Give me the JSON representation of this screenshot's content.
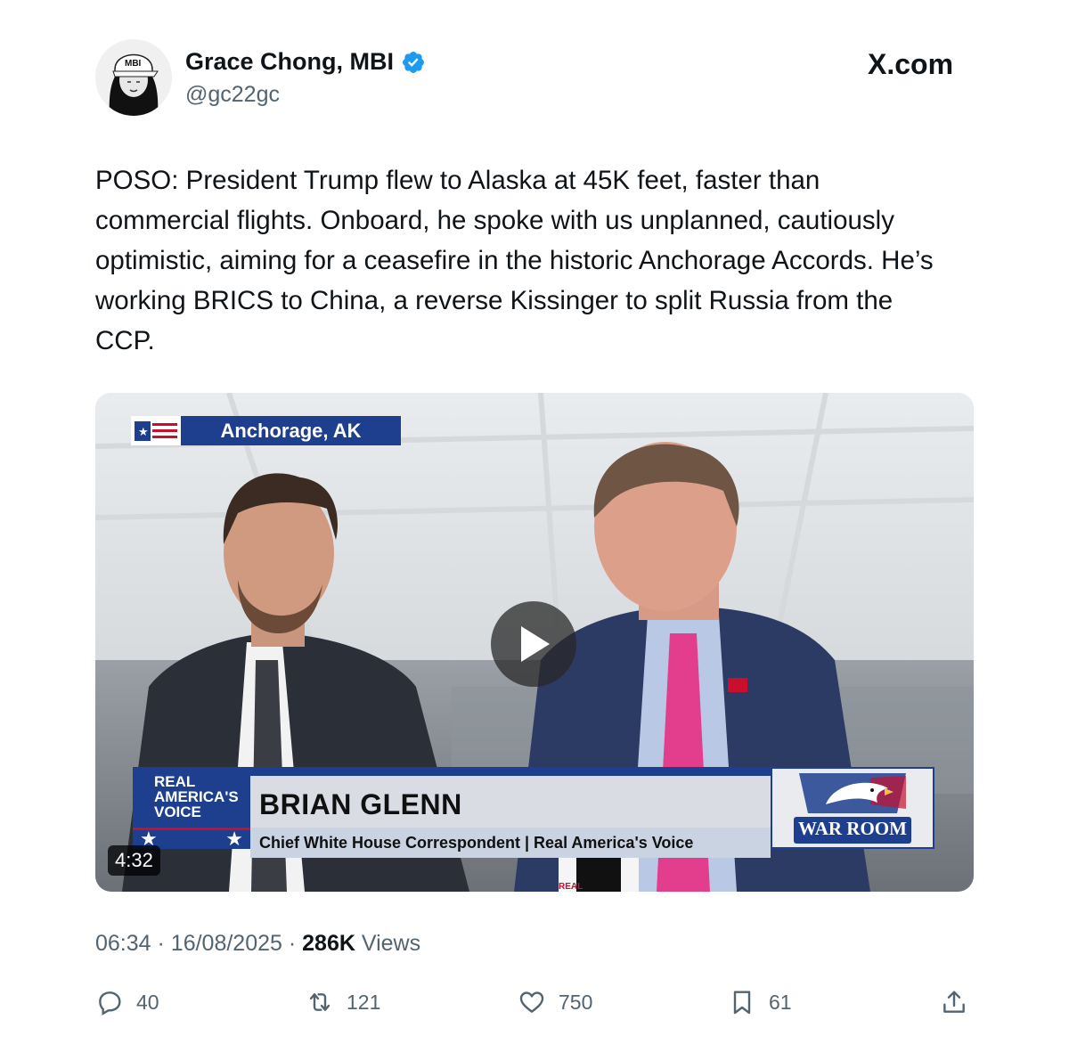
{
  "author": {
    "display_name": "Grace Chong, MBI",
    "handle": "@gc22gc",
    "avatar_cap_text": "MBI",
    "verified_icon": "verified-badge-icon"
  },
  "brand": {
    "site": "X.com"
  },
  "tweet": {
    "text": "POSO: President Trump flew to Alaska at 45K feet, faster than commercial flights. Onboard, he spoke with us unplanned, cautiously optimistic, aiming for a ceasefire in the historic Anchorage Accords. He’s working BRICS to China, a reverse Kissinger to split Russia from the CCP."
  },
  "video": {
    "location": "Anchorage, AK",
    "network_logo": "REAL AMERICA'S VOICE",
    "network_logo_line1": "REAL",
    "network_logo_line2": "AMERICA'S",
    "network_logo_line3": "VOICE",
    "guest_name": "BRIAN GLENN",
    "guest_title": "Chief White House Correspondent | Real America's Voice",
    "show_logo": "WAR ROOM",
    "duration": "4:32",
    "mic_flag_text": "REAL"
  },
  "meta": {
    "time": "06:34",
    "separator": "·",
    "date": "16/08/2025",
    "views_count": "286K",
    "views_label": "Views"
  },
  "actions": {
    "replies": "40",
    "reposts": "121",
    "likes": "750",
    "bookmarks": "61"
  },
  "colors": {
    "text_primary": "#0f1419",
    "text_secondary": "#536471",
    "verified": "#1d9bf0",
    "rav_blue": "#1d3f8e",
    "rav_red": "#c8102e"
  }
}
